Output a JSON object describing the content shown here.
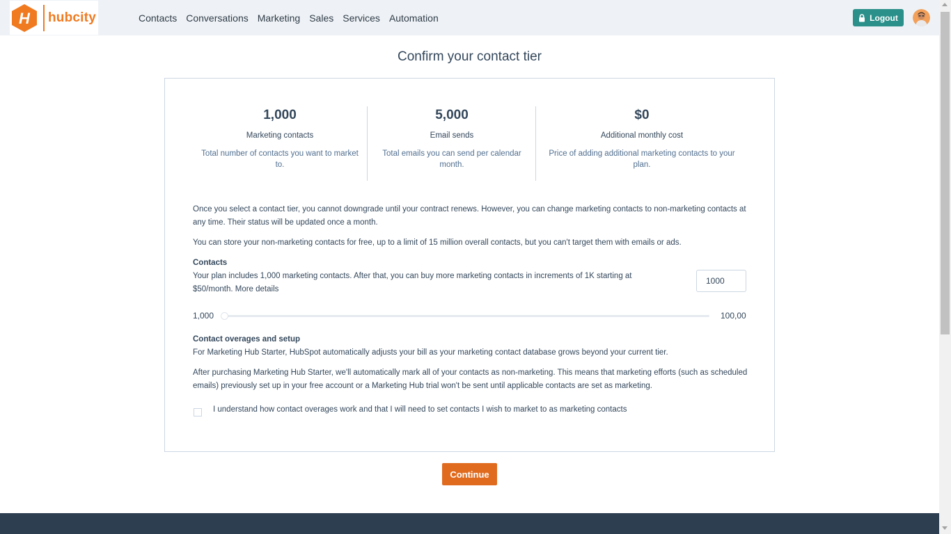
{
  "brand": {
    "name": "hubcity",
    "mark_letter": "H",
    "accent": "#f07a20"
  },
  "nav": {
    "items": [
      {
        "label": "Contacts"
      },
      {
        "label": "Conversations"
      },
      {
        "label": "Marketing"
      },
      {
        "label": "Sales"
      },
      {
        "label": "Services"
      },
      {
        "label": "Automation"
      }
    ]
  },
  "header": {
    "logout_label": "Logout",
    "logout_icon": "lock-icon",
    "logout_color": "#2b8f8a"
  },
  "page": {
    "title": "Confirm your contact tier"
  },
  "stats": [
    {
      "value": "1,000",
      "label": "Marketing contacts",
      "desc_line1": "Total number of contacts you want to market",
      "desc_line2": "to."
    },
    {
      "value": "5,000",
      "label": "Email sends",
      "desc_line1": "Total emails you can send per calendar",
      "desc_line2": "month."
    },
    {
      "value": "$0",
      "label": "Additional monthly cost",
      "desc_line1": "Price of adding additional marketing contacts to your",
      "desc_line2": "plan."
    }
  ],
  "intro": {
    "p1_line1": "Once you select a contact tier, you cannot downgrade until your contract renews. However, you can change marketing contacts to non-marketing contacts at",
    "p1_line2": "any time. Their status will be updated once a month.",
    "p2": "You can store your non-marketing contacts for free, up to a limit of 15 million overall contacts, but you can't target them with emails or ads."
  },
  "contacts": {
    "heading": "Contacts",
    "desc_line1": "Your plan includes 1,000 marketing contacts. After that, you can buy more marketing contacts in increments of 1K starting at",
    "desc_line2": "$50/month. More details",
    "input_value": "1000",
    "slider_min_label": "1,000",
    "slider_max_label": "100,00",
    "slider_value_fraction": 0.0
  },
  "overages": {
    "heading": "Contact overages and setup",
    "p1": "For Marketing Hub Starter, HubSpot automatically adjusts your bill as your marketing contact database grows beyond your current tier.",
    "p2_line1": "After purchasing Marketing Hub Starter, we'll automatically mark all of your contacts as non-marketing. This means that marketing efforts (such as scheduled",
    "p2_line2": "emails) previously set up in your free account or a Marketing Hub trial won't be sent until applicable contacts are set as marketing.",
    "checkbox_label": "I understand how contact overages work and that I will need to set contacts I wish to market to as marketing contacts",
    "checkbox_checked": false
  },
  "actions": {
    "continue_label": "Continue",
    "continue_color": "#e06b1f"
  },
  "footer": {
    "color": "#2d3e50"
  }
}
